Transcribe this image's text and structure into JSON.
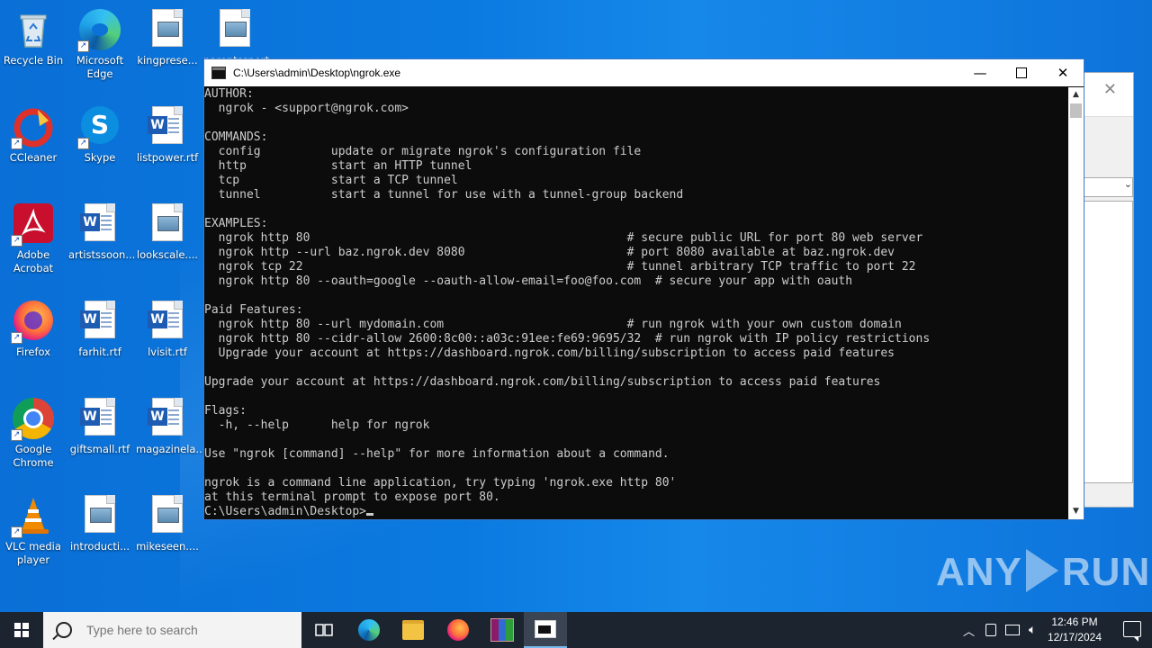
{
  "desktop": {
    "icons": [
      {
        "label": "Recycle Bin"
      },
      {
        "label": "Microsoft Edge"
      },
      {
        "label": "kingprese..."
      },
      {
        "label": "parentssport..."
      },
      {
        "label": "CCleaner"
      },
      {
        "label": "Skype"
      },
      {
        "label": "listpower.rtf"
      },
      {
        "label": "Adobe Acrobat"
      },
      {
        "label": "artistssoon..."
      },
      {
        "label": "lookscale...."
      },
      {
        "label": "Firefox"
      },
      {
        "label": "farhit.rtf"
      },
      {
        "label": "lvisit.rtf"
      },
      {
        "label": "Google Chrome"
      },
      {
        "label": "giftsmall.rtf"
      },
      {
        "label": "magazinela..."
      },
      {
        "label": "VLC media player"
      },
      {
        "label": "introducti..."
      },
      {
        "label": "mikeseen...."
      }
    ]
  },
  "console": {
    "title": "C:\\Users\\admin\\Desktop\\ngrok.exe",
    "output": "AUTHOR:\n  ngrok - <support@ngrok.com>\n\nCOMMANDS:\n  config          update or migrate ngrok's configuration file\n  http            start an HTTP tunnel\n  tcp             start a TCP tunnel\n  tunnel          start a tunnel for use with a tunnel-group backend\n\nEXAMPLES:\n  ngrok http 80                                             # secure public URL for port 80 web server\n  ngrok http --url baz.ngrok.dev 8080                       # port 8080 available at baz.ngrok.dev\n  ngrok tcp 22                                              # tunnel arbitrary TCP traffic to port 22\n  ngrok http 80 --oauth=google --oauth-allow-email=foo@foo.com  # secure your app with oauth\n\nPaid Features:\n  ngrok http 80 --url mydomain.com                          # run ngrok with your own custom domain\n  ngrok http 80 --cidr-allow 2600:8c00::a03c:91ee:fe69:9695/32  # run ngrok with IP policy restrictions\n  Upgrade your account at https://dashboard.ngrok.com/billing/subscription to access paid features\n\nUpgrade your account at https://dashboard.ngrok.com/billing/subscription to access paid features\n\nFlags:\n  -h, --help      help for ngrok\n\nUse \"ngrok [command] --help\" for more information about a command.\n\nngrok is a command line application, try typing 'ngrok.exe http 80'\nat this terminal prompt to expose port 80.",
    "prompt": "C:\\Users\\admin\\Desktop>"
  },
  "taskbar": {
    "search_placeholder": "Type here to search",
    "time": "12:46 PM",
    "date": "12/17/2024"
  },
  "watermark": {
    "left": "ANY",
    "right": "RUN"
  }
}
